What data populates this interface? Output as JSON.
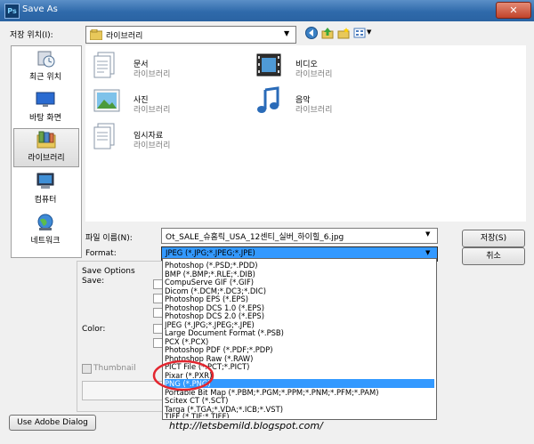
{
  "window": {
    "title": "Save As",
    "close_label": "✕",
    "app_icon_text": "Ps"
  },
  "save_in": {
    "label": "저장 위치(I):",
    "value": "라이브러리"
  },
  "toolbar": {
    "icons": [
      "back-icon",
      "up-folder-icon",
      "new-folder-icon",
      "view-menu-icon"
    ]
  },
  "places": [
    {
      "label": "최근 위치",
      "icon": "recent-places-icon"
    },
    {
      "label": "바탕 화면",
      "icon": "desktop-icon"
    },
    {
      "label": "라이브러리",
      "icon": "libraries-icon",
      "selected": true
    },
    {
      "label": "컴퓨터",
      "icon": "computer-icon"
    },
    {
      "label": "네트워크",
      "icon": "network-icon"
    }
  ],
  "files": [
    {
      "name": "문서",
      "sub": "라이브러리",
      "icon": "documents-library-icon"
    },
    {
      "name": "비디오",
      "sub": "라이브러리",
      "icon": "videos-library-icon"
    },
    {
      "name": "사진",
      "sub": "라이브러리",
      "icon": "pictures-library-icon"
    },
    {
      "name": "음악",
      "sub": "라이브러리",
      "icon": "music-library-icon"
    },
    {
      "name": "임시자료",
      "sub": "라이브러리",
      "icon": "temp-library-icon"
    }
  ],
  "filename": {
    "label": "파일 이름(N):",
    "value": "Ot_SALE_슈홈릭_USA_12센티_실버_하이힐_6.jpg"
  },
  "format": {
    "label": "Format:",
    "value": "JPEG (*.JPG;*.JPEG;*.JPE)",
    "options": [
      "Photoshop (*.PSD;*.PDD)",
      "BMP (*.BMP;*.RLE;*.DIB)",
      "CompuServe GIF (*.GIF)",
      "Dicom (*.DCM;*.DC3;*.DIC)",
      "Photoshop EPS (*.EPS)",
      "Photoshop DCS 1.0 (*.EPS)",
      "Photoshop DCS 2.0 (*.EPS)",
      "JPEG (*.JPG;*.JPEG;*.JPE)",
      "Large Document Format (*.PSB)",
      "PCX (*.PCX)",
      "Photoshop PDF (*.PDF;*.PDP)",
      "Photoshop Raw (*.RAW)",
      "PICT File (*.PCT;*.PICT)",
      "Pixar (*.PXR)",
      "PNG (*.PNG)",
      "Portable Bit Map (*.PBM;*.PGM;*.PPM;*.PNM;*.PFM;*.PAM)",
      "Scitex CT (*.SCT)",
      "Targa (*.TGA;*.VDA;*.ICB;*.VST)",
      "TIFF (*.TIF;*.TIFF)"
    ],
    "highlighted": "PNG (*.PNG)"
  },
  "buttons": {
    "save": "저장(S)",
    "cancel": "취소",
    "adobe_dialog": "Use Adobe Dialog"
  },
  "save_options": {
    "heading": "Save Options",
    "save_label": "Save:",
    "color_label": "Color:",
    "thumbnail_label": "Thumbnail"
  },
  "watermark": "http://letsbemild.blogspot.com/",
  "colors": {
    "title_bar": "#2f6aab",
    "highlight": "#3399ff",
    "annotation": "#e3262f"
  }
}
